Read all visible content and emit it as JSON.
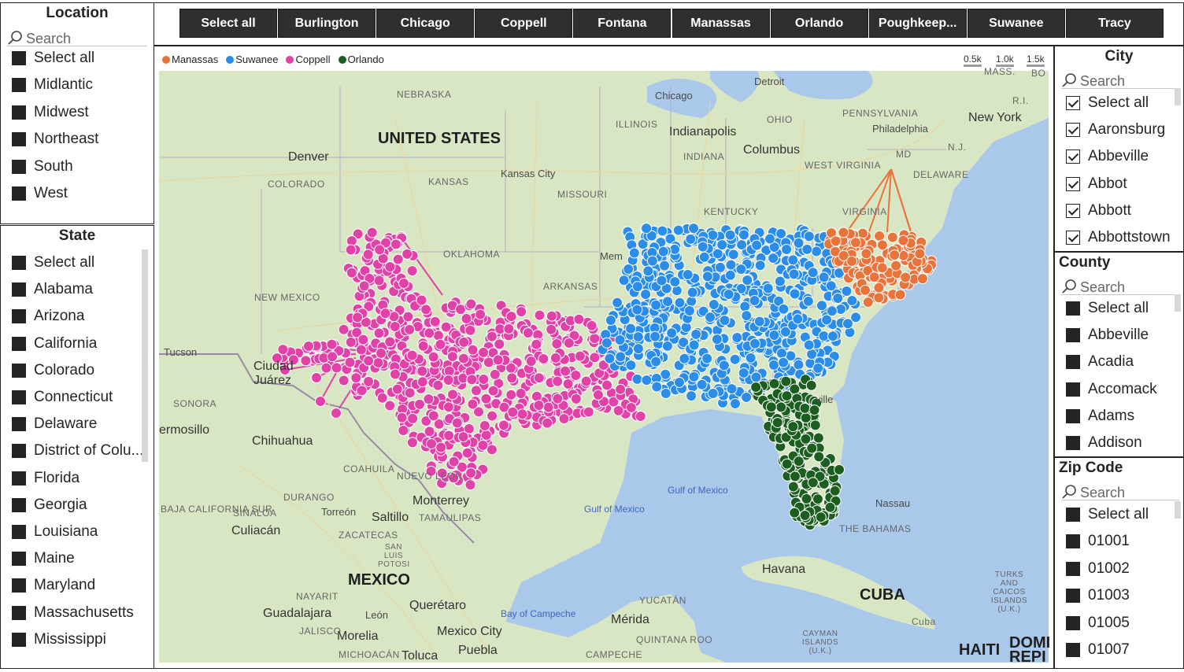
{
  "location_slicer": {
    "title": "Location",
    "search_placeholder": "Search",
    "items": [
      "Select all",
      "Midlantic",
      "Midwest",
      "Northeast",
      "South",
      "West"
    ]
  },
  "state_slicer": {
    "title": "State",
    "items": [
      "Select all",
      "Alabama",
      "Arizona",
      "California",
      "Colorado",
      "Connecticut",
      "Delaware",
      "District of Colu...",
      "Florida",
      "Georgia",
      "Louisiana",
      "Maine",
      "Maryland",
      "Massachusetts",
      "Mississippi"
    ]
  },
  "city_buttons": [
    "Select all",
    "Burlington",
    "Chicago",
    "Coppell",
    "Fontana",
    "Manassas",
    "Orlando",
    "Poughkeep...",
    "Suwanee",
    "Tracy"
  ],
  "legend": [
    {
      "label": "Manassas",
      "color": "#e8743b"
    },
    {
      "label": "Suwanee",
      "color": "#2b8de8"
    },
    {
      "label": "Coppell",
      "color": "#e042a8"
    },
    {
      "label": "Orlando",
      "color": "#1b5e20"
    }
  ],
  "zoom_levels": [
    "0.5k",
    "1.0k",
    "1.5k"
  ],
  "map_labels": {
    "us": "UNITED STATES",
    "mexico": "MEXICO",
    "cuba": "CUBA",
    "bahamas": "THE BAHAMAS",
    "haiti": "HAITI",
    "domi": "DOMI REPI",
    "chicago": "Chicago",
    "detroit": "Detroit",
    "newyork": "New York",
    "philadelphia": "Philadelphia",
    "indianapolis": "Indianapolis",
    "columbus": "Columbus",
    "denver": "Denver",
    "kansascity": "Kansas City",
    "tucson": "Tucson",
    "juarez": "Ciudad Juárez",
    "chihuahua": "Chihuahua",
    "hermosillo": "ermosillo",
    "monterrey": "Monterrey",
    "torreon": "Torreón",
    "saltillo": "Saltillo",
    "culiacan": "Culiacán",
    "guadalajara": "Guadalajara",
    "queretaro": "Querétaro",
    "leon": "León",
    "morelia": "Morelia",
    "mexicocity": "Mexico City",
    "puebla": "Puebla",
    "toluca": "Toluca",
    "merida": "Mérida",
    "havana": "Havana",
    "nassau": "Nassau",
    "memphis": "Mem",
    "ville": "ville",
    "nebraska": "NEBRASKA",
    "illinois": "ILLINOIS",
    "ohio": "OHIO",
    "pennsylvania": "PENNSYLVANIA",
    "indiana": "INDIANA",
    "colorado": "COLORADO",
    "kansas": "KANSAS",
    "missouri": "MISSOURI",
    "westvirginia": "WEST VIRGINIA",
    "kentucky": "KENTUCKY",
    "virginia": "VIRGINIA",
    "oklahoma": "OKLAHOMA",
    "arkansas": "ARKANSAS",
    "newmexico": "NEW MEXICO",
    "sonora": "SONORA",
    "coahuila": "COAHUILA",
    "nuevoleon": "NUEVO LEON",
    "durango": "DURANGO",
    "sinaloa": "SINALOA",
    "zacatecas": "ZACATECAS",
    "sanluis": "SAN LUIS POTOSI",
    "tamaulipas": "TAMAULIPAS",
    "nayarit": "NAYARIT",
    "jalisco": "JALISCO",
    "michoacan": "MICHOACÁN",
    "campeche": "CAMPECHE",
    "yucatan": "YUCATÁN",
    "quintana": "QUINTANA ROO",
    "bajacal": "BAJA CALIFORNIA SUR",
    "md": "MD",
    "nj": "N.J.",
    "delaware": "DELAWARE",
    "ri": "R.I.",
    "mass": "MASS.",
    "bo": "BO",
    "turks": "TURKS AND CAICOS ISLANDS (U.K.)",
    "cayman": "CAYMAN ISLANDS (U.K.)",
    "cuba_small": "Cuba",
    "gulf1": "Gulf of Mexico",
    "gulf2": "Gulf of Mexico",
    "campeche_bay": "Bay of Campeche"
  },
  "city_slicer": {
    "title": "City",
    "search_placeholder": "Search",
    "items": [
      "Select all",
      "Aaronsburg",
      "Abbeville",
      "Abbot",
      "Abbott",
      "Abbottstown"
    ]
  },
  "county_slicer": {
    "title": "County",
    "search_placeholder": "Search",
    "items": [
      "Select all",
      "Abbeville",
      "Acadia",
      "Accomack",
      "Adams",
      "Addison"
    ]
  },
  "zip_slicer": {
    "title": "Zip Code",
    "search_placeholder": "Search",
    "items": [
      "Select all",
      "01001",
      "01002",
      "01003",
      "01005",
      "01007"
    ]
  }
}
